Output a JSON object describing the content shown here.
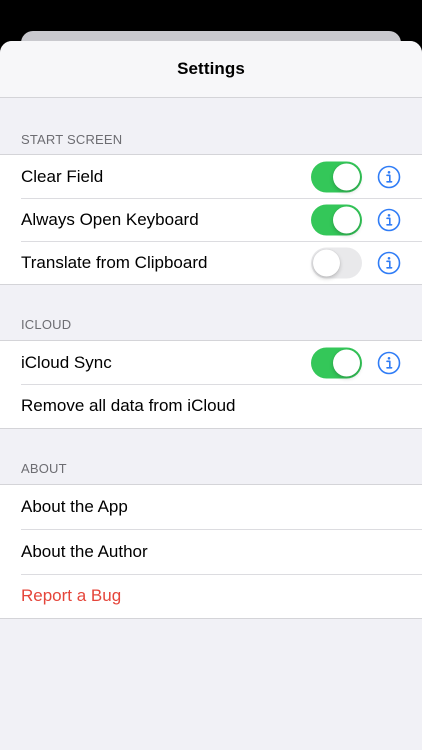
{
  "nav": {
    "title": "Settings"
  },
  "sections": [
    {
      "header": "START SCREEN",
      "rows": [
        {
          "label": "Clear Field",
          "toggle": true,
          "info": true
        },
        {
          "label": "Always Open Keyboard",
          "toggle": true,
          "info": true
        },
        {
          "label": "Translate from Clipboard",
          "toggle": false,
          "info": true
        }
      ]
    },
    {
      "header": "ICLOUD",
      "rows": [
        {
          "label": "iCloud Sync",
          "toggle": true,
          "info": true
        },
        {
          "label": "Remove all data from iCloud"
        }
      ]
    },
    {
      "header": "ABOUT",
      "rows": [
        {
          "label": "About the App"
        },
        {
          "label": "About the Author"
        },
        {
          "label": "Report a Bug"
        }
      ]
    }
  ],
  "colors": {
    "toggle_on": "#34c759",
    "toggle_off": "#e9e9eb",
    "info_icon": "#2f7cf6",
    "destructive": "#e5453a"
  },
  "icons": {
    "info": "info-circle-icon"
  }
}
